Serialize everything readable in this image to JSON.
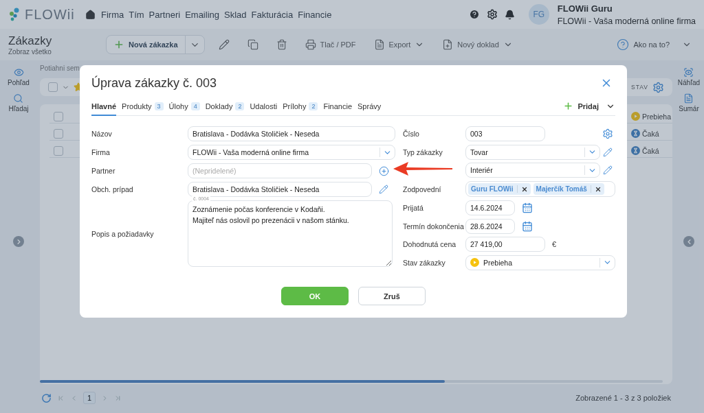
{
  "nav": {
    "logo": "FLOWii",
    "items": [
      "Firma",
      "Tím",
      "Partneri",
      "Emailing",
      "Sklad",
      "Fakturácia",
      "Financie"
    ],
    "avatar": "FG",
    "user": "FLOWii Guru",
    "company": "FLOWii - Vaša moderná online firma"
  },
  "toolbar": {
    "title": "Zákazky",
    "subtitle": "Zobraz všetko",
    "new_button": "Nová zákazka",
    "actions": [
      {
        "kind": "edit"
      },
      {
        "kind": "copy"
      },
      {
        "kind": "delete"
      },
      {
        "kind": "print",
        "label": "Tlač / PDF",
        "menu": false
      },
      {
        "kind": "export",
        "label": "Export",
        "menu": true
      },
      {
        "kind": "new-doc",
        "label": "Nový doklad",
        "menu": true
      }
    ],
    "help": "Ako na to?"
  },
  "left_sidebar": [
    {
      "kind": "view",
      "label": "Pohľad"
    },
    {
      "kind": "search",
      "label": "Hľadaj"
    }
  ],
  "right_sidebar": [
    {
      "kind": "preview",
      "label": "Náhľad"
    },
    {
      "kind": "summary",
      "label": "Sumár"
    }
  ],
  "list": {
    "hint": "Potiahni sem",
    "status_column": "STAV",
    "rows": [
      {
        "status": "Prebieha",
        "kind": "running",
        "checked": false
      },
      {
        "status": "Čaká",
        "kind": "waiting",
        "checked": false
      },
      {
        "status": "Čaká",
        "kind": "waiting",
        "checked": false
      }
    ],
    "select_all": {
      "checked": false
    }
  },
  "pager": {
    "page": "1",
    "summary": "Zobrazené 1 - 3 z 3 položiek"
  },
  "dialog": {
    "title": "Úprava zákazky č. 003",
    "tabs": [
      {
        "label": "Hlavné",
        "selected": true
      },
      {
        "label": "Produkty",
        "count": "3",
        "selected": false
      },
      {
        "label": "Úlohy",
        "count": "4",
        "selected": false
      },
      {
        "label": "Doklady",
        "count": "2",
        "selected": false
      },
      {
        "label": "Udalosti",
        "selected": false
      },
      {
        "label": "Prílohy",
        "count": "2",
        "selected": false
      },
      {
        "label": "Financie",
        "selected": false
      },
      {
        "label": "Správy",
        "selected": false
      }
    ],
    "add_button": "Pridaj",
    "left_fields": [
      {
        "label": "Názov",
        "kind": "text",
        "value": "Bratislava - Dodávka Stoličiek - Neseda"
      },
      {
        "label": "Firma",
        "kind": "select",
        "value": "FLOWii - Vaša moderná online firma"
      },
      {
        "label": "Partner",
        "kind": "text",
        "placeholder": "(Nepridelené)",
        "action": {
          "kind": "add"
        }
      },
      {
        "label": "Obch. prípad",
        "kind": "text",
        "value": "Bratislava - Dodávka Stoličiek - Neseda",
        "note": "č. 0004",
        "action": {
          "kind": "edit"
        }
      },
      {
        "label": "Popis a požiadavky",
        "kind": "textarea",
        "lines": [
          "Zoznámenie počas konferencie v Kodaňi.",
          "Majiteľ nás oslovil po prezenácii v našom stánku."
        ]
      }
    ],
    "right_fields": [
      {
        "label": "Číslo",
        "kind": "text",
        "value": "003",
        "action": {
          "kind": "settings"
        }
      },
      {
        "label": "Typ zákazky",
        "kind": "select",
        "value": "Tovar",
        "action": {
          "kind": "edit"
        }
      },
      {
        "kind": "select",
        "value": "Interiér",
        "action": {
          "kind": "edit"
        }
      },
      {
        "label": "Zodpovední",
        "kind": "tags",
        "tags": [
          "Guru FLOWii",
          "Majerčík Tomáš"
        ]
      },
      {
        "label": "Prijatá",
        "kind": "date",
        "value": "14.6.2024"
      },
      {
        "label": "Termín dokončenia",
        "kind": "date",
        "value": "28.6.2024"
      },
      {
        "label": "Dohodnutá cena",
        "kind": "money",
        "value": "27 419,00",
        "currency": "€"
      },
      {
        "label": "Stav zákazky",
        "kind": "status",
        "value": "Prebieha",
        "status": {
          "kind": "running"
        }
      }
    ],
    "buttons": [
      {
        "kind": "primary",
        "label": "OK"
      },
      {
        "kind": "secondary",
        "label": "Zruš"
      }
    ]
  }
}
